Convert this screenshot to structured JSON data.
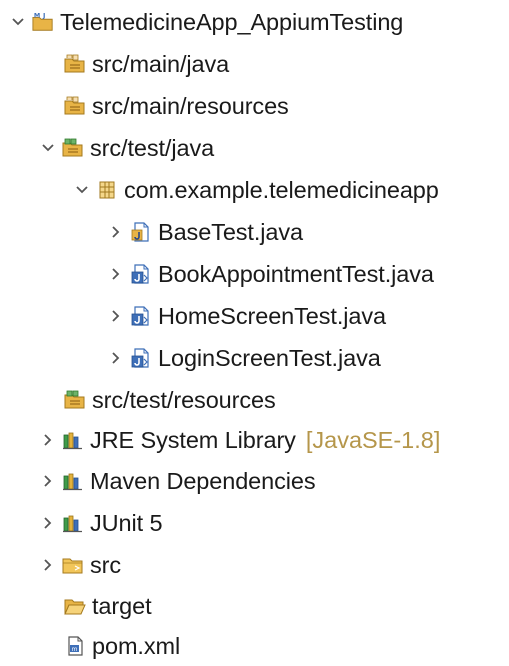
{
  "explorer": {
    "project": {
      "label": "TelemedicineApp_AppiumTesting",
      "expanded": true,
      "icon": "maven-project-icon"
    },
    "items": [
      {
        "label": "src/main/java",
        "icon": "source-folder-icon"
      },
      {
        "label": "src/main/resources",
        "icon": "source-folder-icon"
      },
      {
        "label": "src/test/java",
        "icon": "test-source-folder-icon",
        "expanded": true
      },
      {
        "label": "com.example.telemedicineapp",
        "icon": "package-icon",
        "expanded": true
      },
      {
        "label": "BaseTest.java",
        "icon": "java-file-icon"
      },
      {
        "label": "BookAppointmentTest.java",
        "icon": "junit-test-file-icon"
      },
      {
        "label": "HomeScreenTest.java",
        "icon": "junit-test-file-icon"
      },
      {
        "label": "LoginScreenTest.java",
        "icon": "junit-test-file-icon"
      },
      {
        "label": "src/test/resources",
        "icon": "test-source-folder-icon"
      },
      {
        "label": "JRE System Library",
        "decoration": "[JavaSE-1.8]",
        "icon": "library-icon"
      },
      {
        "label": "Maven Dependencies",
        "icon": "library-icon"
      },
      {
        "label": "JUnit 5",
        "icon": "library-icon"
      },
      {
        "label": "src",
        "icon": "folder-icon"
      },
      {
        "label": "target",
        "icon": "open-folder-icon"
      },
      {
        "label": "pom.xml",
        "icon": "xml-file-icon"
      }
    ]
  },
  "colors": {
    "text": "#1a1a1a",
    "decoration": "#b5964a",
    "chevron": "#555555",
    "folder": "#e8b446",
    "package": "#c9a23c",
    "java_blue": "#3e6fb8",
    "library_green": "#3f9b4a"
  }
}
